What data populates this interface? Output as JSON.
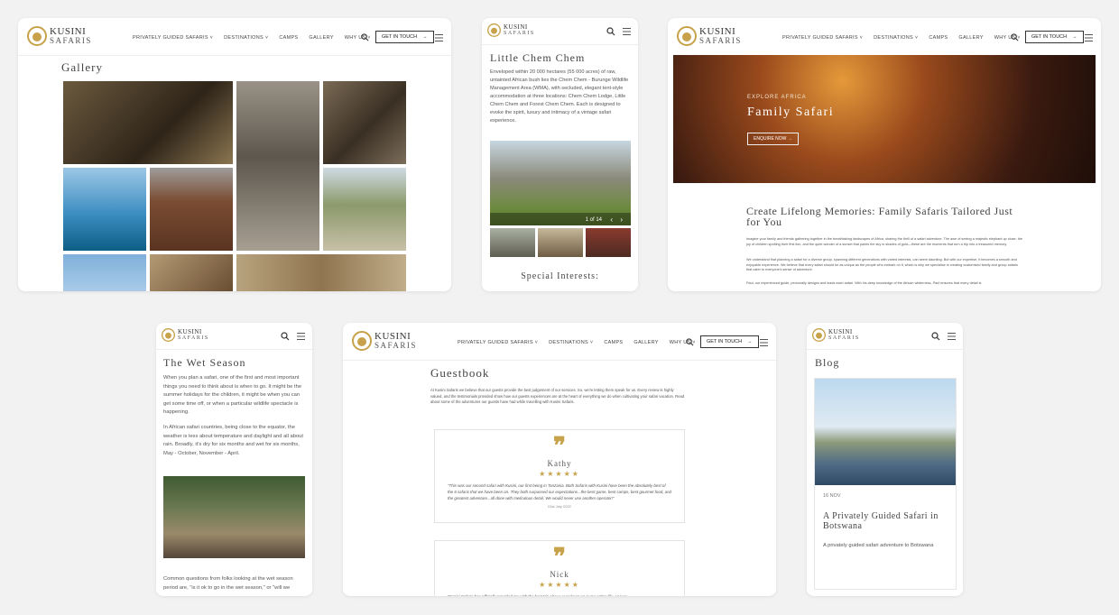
{
  "brand": {
    "line1": "KUSINI",
    "line2": "SAFARIS",
    "accent": "#c7a24a"
  },
  "menu": [
    "PRIVATELY GUIDED SAFARIS ˅",
    "DESTINATIONS ˅",
    "CAMPS",
    "GALLERY",
    "WHY US ˅"
  ],
  "cta_label": "GET IN TOUCH",
  "gallery": {
    "title": "Gallery"
  },
  "chem": {
    "title": "Little Chem Chem",
    "body": "Enveloped within 20 000 hectares (55 000 acres) of raw, untainted African bush lies the Chem Chem - Burunge Wildlife Management Area (WMA), with secluded, elegant tent-style accommodation at three locations: Chem Chem Lodge, Little Chem Chem and Forest Chem Chem. Each is designed to evoke the spirit, luxury and intimacy of a vintage safari experience.",
    "counter": "1 of 14",
    "section": "Special Interests:"
  },
  "family": {
    "kicker": "EXPLORE AFRICA",
    "title": "Family Safari",
    "button": "ENQUIRE NOW",
    "heading": "Create Lifelong Memories: Family Safaris Tailored Just for You",
    "p1": "Imagine your family and friends gathering together in the breathtaking landscapes of Africa, sharing the thrill of a safari adventure. The awe of seeing a majestic elephant up close, the joy of children spotting their first lion, and the quiet wonder of a sunset that paints the sky in shades of gold—these are the moments that turn a trip into a treasured memory.",
    "p2": "We understand that planning a safari for a diverse group, spanning different generations with varied interests, can seem daunting. But with our expertise, it becomes a smooth and enjoyable experience. We believe that every safari should be as unique as the people who embark on it, which is why we specialise in creating customised family and group safaris that cater to everyone's sense of adventure.",
    "p3": "Paul, our experienced guide, personally designs and leads each safari. With his deep knowledge of the African wilderness, Paul ensures that every detail is"
  },
  "wet": {
    "title": "The Wet Season",
    "p1": "When you plan a safari, one of the first and most important things you need to think about is when to go. It might be the summer holidays for the children, it might be when you can get some time off, or when a particular wildlife spectacle is happening.",
    "p2": "In African safari countries, being close to the equator, the weather is less about temperature and daylight and all about rain. Broadly, it's dry for six months and wet for six months, May - October, November - April.",
    "p3": "Common questions from folks looking at the wet season period are, \"is it ok to go in the wet season,\" or \"will we"
  },
  "guestbook": {
    "title": "Guestbook",
    "intro": "At Kusini Safaris we believe that our guests provide the best judgement of our services. So, we're letting them speak for us. Every review is highly valued, and the testimonials provided show how our guests experiences are at the heart of everything we do when cultivating your safari vacation. Read about some of the adventures our guests have had while travelling with Kusini Safaris.",
    "reviews": [
      {
        "name": "Kathy",
        "stars": "★★★★★",
        "text": "\"This was our second safari with Kusini, our first being in Tanzania. Both Safaris with Kusini have been the absolutely best of the 6 safaris that we have been on. They both surpassed our expectations...the best game, best camps, best gourmet food, and the greatest adventure...all done with meticulous detail. We would never use another operator!\"",
        "date": "01st July 2022"
      },
      {
        "name": "Nick",
        "stars": "★★★★★",
        "text": "\"Kusini Safaris has officially provided me with the best trip I have ever been on in my entire life. I never",
        "date": ""
      }
    ]
  },
  "blog": {
    "title": "Blog",
    "date": "16 NOV",
    "post_title": "A Privately Guided Safari in Botswana",
    "excerpt": "A privately guided safari adventure to Botswana"
  }
}
